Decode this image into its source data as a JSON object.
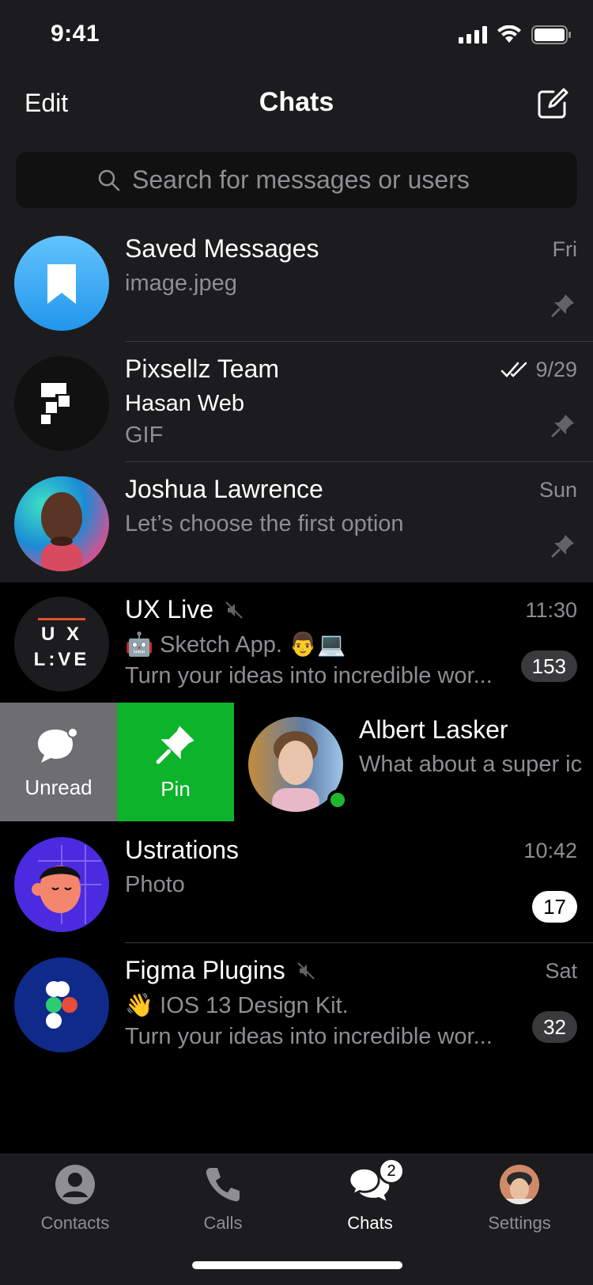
{
  "status": {
    "time": "9:41"
  },
  "nav": {
    "edit": "Edit",
    "title": "Chats"
  },
  "search": {
    "placeholder": "Search for messages or users"
  },
  "chats": [
    {
      "name": "Saved Messages",
      "preview": "image.jpeg",
      "time": "Fri",
      "pinned": true
    },
    {
      "name": "Pixsellz Team",
      "sender": "Hasan Web",
      "preview": "GIF",
      "time": "9/29",
      "pinned": true,
      "read": true
    },
    {
      "name": "Joshua Lawrence",
      "preview": "Let’s choose the first option",
      "time": "Sun",
      "pinned": true
    },
    {
      "name": "UX Live",
      "muted": true,
      "preview_line1": "🤖 Sketch App. 👨💻",
      "preview_line2": "Turn your ideas into incredible wor...",
      "time": "11:30",
      "unread": "153",
      "avatar_text_top": "U X",
      "avatar_text_bottom": "L:VE"
    },
    {
      "name": "Albert Lasker",
      "preview": "What about a super ic",
      "online": true
    },
    {
      "name": "Ustrations",
      "preview": "Photo",
      "time": "10:42",
      "unread": "17"
    },
    {
      "name": "Figma Plugins",
      "muted": true,
      "preview_line1": "👋 IOS 13 Design Kit.",
      "preview_line2": "Turn your ideas into incredible wor...",
      "time": "Sat",
      "unread": "32"
    }
  ],
  "swipe_actions": {
    "unread": "Unread",
    "pin": "Pin"
  },
  "tabs": [
    {
      "label": "Contacts",
      "icon": "person-icon"
    },
    {
      "label": "Calls",
      "icon": "phone-icon"
    },
    {
      "label": "Chats",
      "icon": "chats-icon",
      "badge": "2",
      "active": true
    },
    {
      "label": "Settings",
      "icon": "avatar"
    }
  ],
  "colors": {
    "background": "#1c1c1e",
    "pin_action": "#0db32a",
    "unread_action": "#6d6d72",
    "accent_blue": "#2aa4f4"
  }
}
